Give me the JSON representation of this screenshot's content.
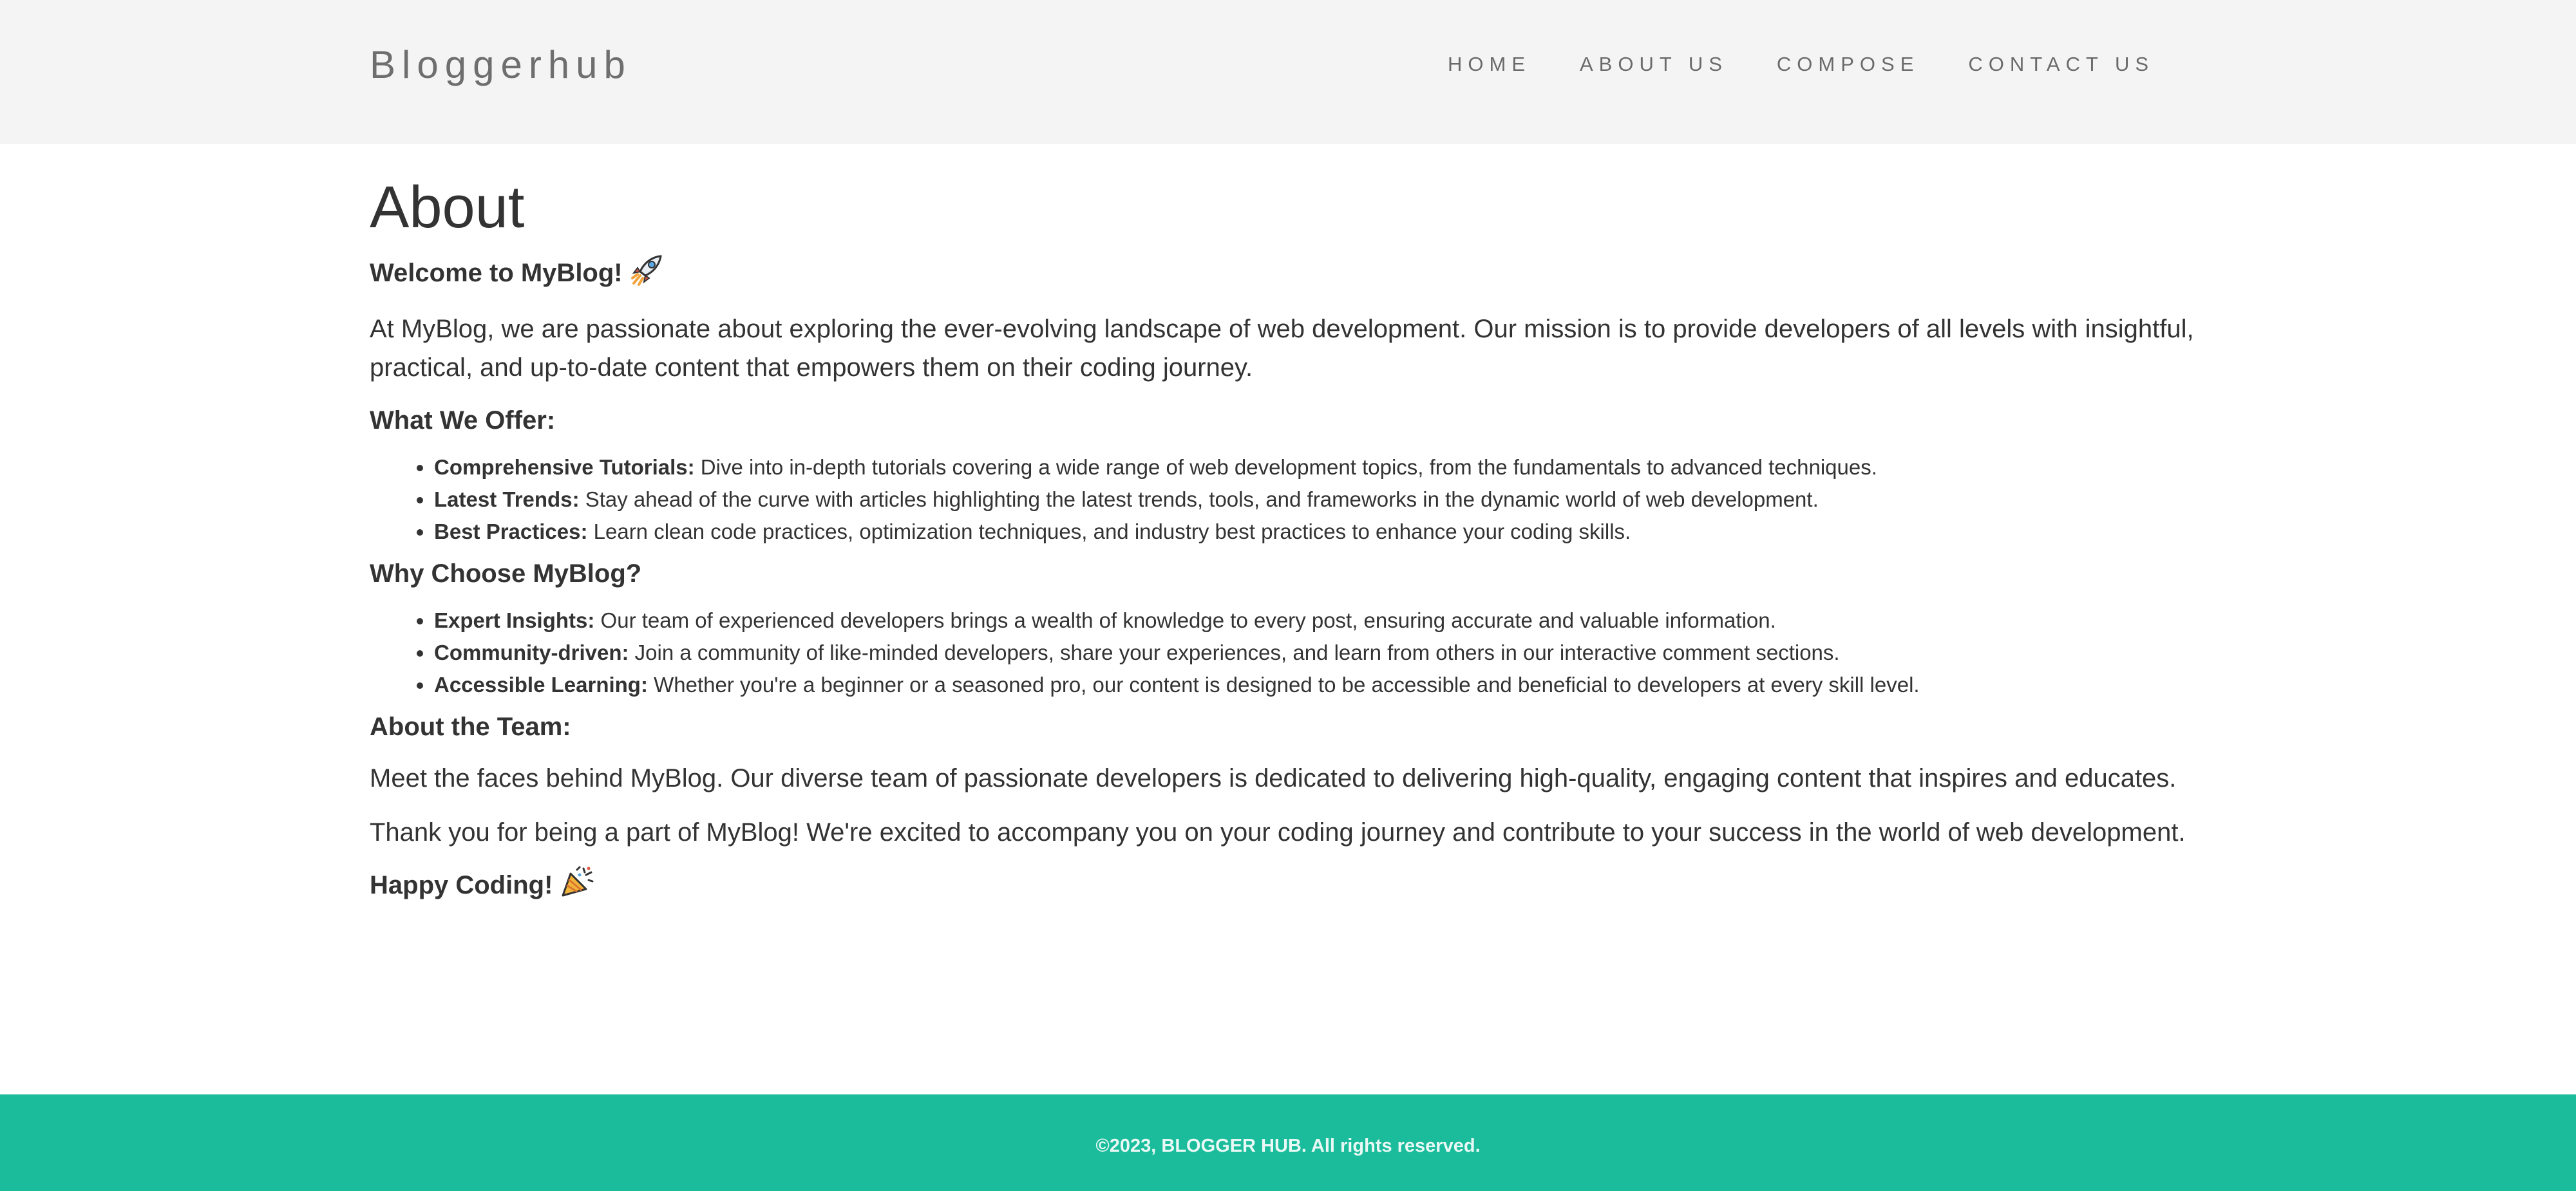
{
  "header": {
    "brand": "Bloggerhub",
    "nav": [
      {
        "label": "HOME"
      },
      {
        "label": "ABOUT US"
      },
      {
        "label": "COMPOSE"
      },
      {
        "label": "CONTACT US"
      }
    ]
  },
  "main": {
    "title": "About",
    "welcome": "Welcome to MyBlog!",
    "intro": "At MyBlog, we are passionate about exploring the ever-evolving landscape of web development. Our mission is to provide developers of all levels with insightful, practical, and up-to-date content that empowers them on their coding journey.",
    "offer_heading": "What We Offer:",
    "offer_items": [
      {
        "term": "Comprehensive Tutorials:",
        "text": " Dive into in-depth tutorials covering a wide range of web development topics, from the fundamentals to advanced techniques."
      },
      {
        "term": "Latest Trends:",
        "text": " Stay ahead of the curve with articles highlighting the latest trends, tools, and frameworks in the dynamic world of web development."
      },
      {
        "term": "Best Practices:",
        "text": " Learn clean code practices, optimization techniques, and industry best practices to enhance your coding skills."
      }
    ],
    "why_heading": "Why Choose MyBlog?",
    "why_items": [
      {
        "term": "Expert Insights:",
        "text": " Our team of experienced developers brings a wealth of knowledge to every post, ensuring accurate and valuable information."
      },
      {
        "term": "Community-driven:",
        "text": " Join a community of like-minded developers, share your experiences, and learn from others in our interactive comment sections."
      },
      {
        "term": "Accessible Learning:",
        "text": " Whether you're a beginner or a seasoned pro, our content is designed to be accessible and beneficial to developers at every skill level."
      }
    ],
    "team_heading": "About the Team:",
    "team_text": "Meet the faces behind MyBlog. Our diverse team of passionate developers is dedicated to delivering high-quality, engaging content that inspires and educates.",
    "thanks_text": "Thank you for being a part of MyBlog! We're excited to accompany you on your coding journey and contribute to your success in the world of web development.",
    "closing": "Happy Coding!",
    "icons": {
      "welcome": "rocket-icon",
      "closing": "party-popper-icon"
    }
  },
  "footer": {
    "text": "©2023, BLOGGER HUB. All rights reserved."
  },
  "colors": {
    "header_bg": "#f4f4f4",
    "footer_bg": "#1abc9c",
    "text": "#333333"
  }
}
